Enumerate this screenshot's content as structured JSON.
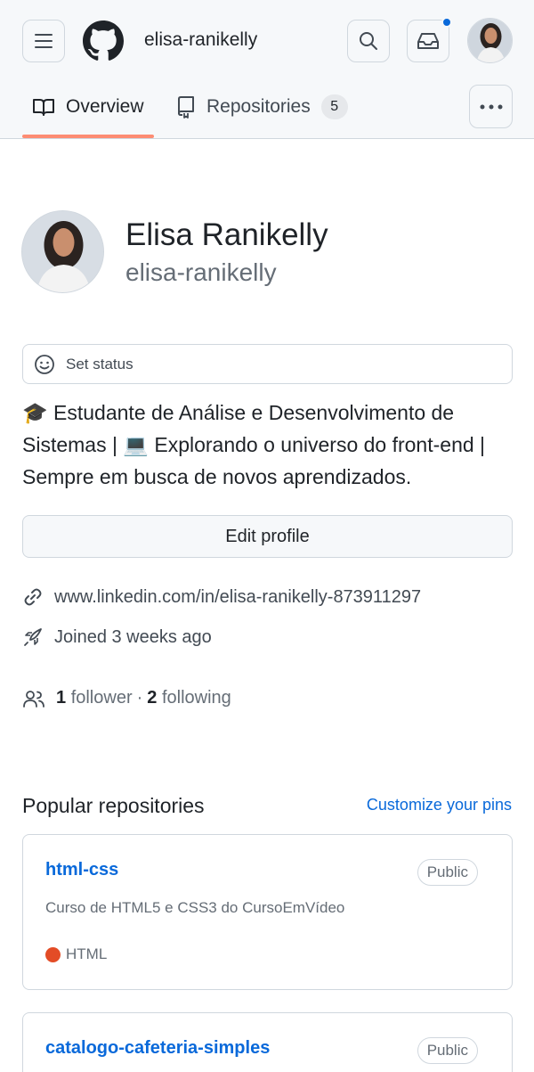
{
  "header": {
    "username": "elisa-ranikelly",
    "icons": {
      "menu": "hamburger-icon",
      "logo": "github-mark-icon",
      "search": "search-icon",
      "inbox": "inbox-icon",
      "more": "kebab-icon"
    },
    "notification_color": "#0969da"
  },
  "tabs": [
    {
      "label": "Overview",
      "icon": "book-icon",
      "active": true
    },
    {
      "label": "Repositories",
      "icon": "repo-icon",
      "count": "5"
    }
  ],
  "profile": {
    "full_name": "Elisa Ranikelly",
    "login": "elisa-ranikelly",
    "set_status_label": "Set status",
    "bio_line1": "🎓 Estudante de Análise e Desenvolvimento de",
    "bio_line2": "Sistemas | 💻 Explorando o universo do front-end |",
    "bio_line3": "Sempre em busca de novos aprendizados.",
    "edit_profile_label": "Edit profile",
    "website": "www.linkedin.com/in/elisa-ranikelly-873911297",
    "joined": "Joined 3 weeks ago",
    "followers_count": "1",
    "followers_label": "follower",
    "separator": "·",
    "following_count": "2",
    "following_label": "following"
  },
  "popular": {
    "title": "Popular repositories",
    "customize_label": "Customize your pins",
    "repos": [
      {
        "name": "html-css",
        "visibility": "Public",
        "description": "Curso de HTML5 e CSS3 do CursoEmVídeo",
        "language": "HTML",
        "language_color": "#e34c26"
      },
      {
        "name": "catalogo-cafeteria-simples",
        "visibility": "Public"
      }
    ]
  },
  "colors": {
    "accent": "#0969da",
    "tab_underline": "#fd8c73"
  }
}
